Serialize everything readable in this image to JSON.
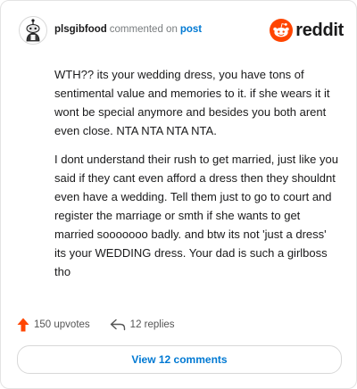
{
  "comment": {
    "username": "plsgibfood",
    "action_text": "commented on",
    "post_link": "post",
    "paragraphs": [
      "WTH?? its your wedding dress, you have tons of sentimental value and memories to it. if she wears it it wont be special anymore and besides you both arent even close. NTA NTA NTA NTA.",
      "I dont understand their rush to get married, just like you said if they cant even afford a dress then they shouldnt even have a wedding. Tell them just to go to court and register the marriage or smth if she wants to get married sooooooo badly. and btw its not 'just a dress' its your WEDDING dress. Your dad is such a girlboss tho"
    ]
  },
  "brand": {
    "name": "reddit",
    "color": "#ff4500",
    "icon": "reddit-alien-icon"
  },
  "actions": {
    "upvotes_label": "150 upvotes",
    "replies_label": "12 replies",
    "upvote_color": "#ff4500"
  },
  "view_button": {
    "label": "View 12 comments",
    "color": "#0079d3"
  }
}
